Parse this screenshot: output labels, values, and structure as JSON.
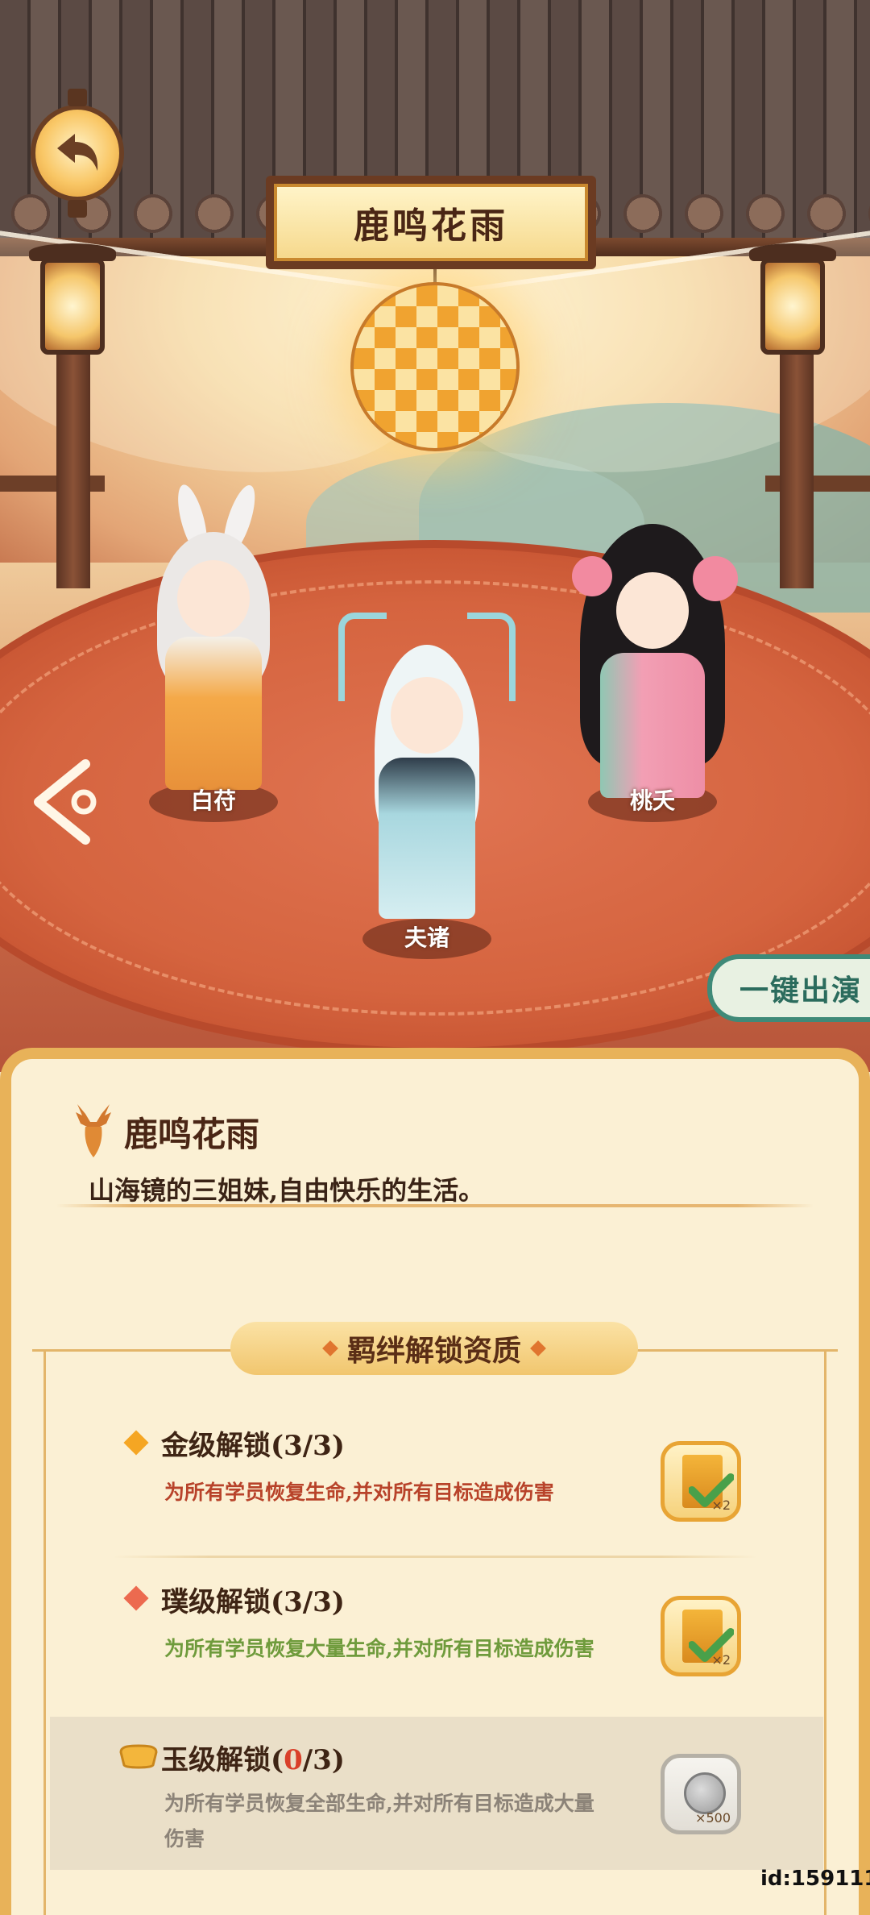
{
  "header": {
    "title": "鹿鸣花雨"
  },
  "characters": [
    {
      "name": "白苻"
    },
    {
      "name": "夫诸"
    },
    {
      "name": "桃夭"
    }
  ],
  "actions": {
    "one_click_perform": "一键出演"
  },
  "bond": {
    "title": "鹿鸣花雨",
    "description": "山海镜的三姐妹,自由快乐的生活。"
  },
  "section": {
    "header": "羁绊解锁资质"
  },
  "unlocks": [
    {
      "title_prefix": "金级解锁(",
      "progress_current": "3",
      "title_suffix": "/3)",
      "description": "为所有学员恢复生命,并对所有目标造成伤害",
      "reward_qty": "×2",
      "reward_label": "履历",
      "claimed": true,
      "color": "#b8432a"
    },
    {
      "title_prefix": "璞级解锁(",
      "progress_current": "3",
      "title_suffix": "/3)",
      "description": "为所有学员恢复大量生命,并对所有目标造成伤害",
      "reward_qty": "×2",
      "reward_label": "履历",
      "claimed": true,
      "color": "#6f9b3c"
    },
    {
      "title_prefix": "玉级解锁(",
      "progress_current": "0",
      "title_suffix": "/3)",
      "description_line1": "为所有学员恢复全部生命,并对所有目标造成大量",
      "description_line2": "伤害",
      "reward_qty": "×500",
      "claimed": false,
      "color": "#8c8378"
    }
  ],
  "footer": {
    "id_text": "id:159111"
  }
}
